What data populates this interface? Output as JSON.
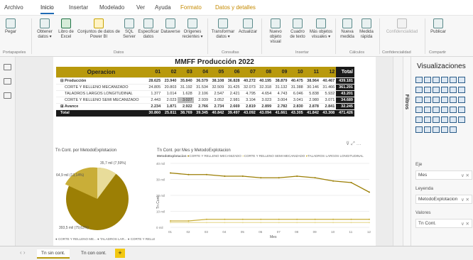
{
  "tabs": [
    "Archivo",
    "Inicio",
    "Insertar",
    "Modelado",
    "Ver",
    "Ayuda",
    "Formato",
    "Datos y detalles"
  ],
  "ribbon": {
    "pegar": "Pegar",
    "obtener": "Obtener datos ▾",
    "libro": "Libro de Excel",
    "conjuntos": "Conjuntos de datos de Power BI",
    "sql": "SQL Server",
    "especificar": "Especificar datos",
    "dataverse": "Dataverse",
    "origenes": "Orígenes recientes ▾",
    "transformar": "Transformar datos ▾",
    "actualizar": "Actualizar",
    "nuevo_objeto": "Nuevo objeto visual",
    "cuadro_texto": "Cuadro de texto",
    "mas_objetos": "Más objetos visuales ▾",
    "nueva_medida": "Nueva medida",
    "medida_rapida": "Medida rápida",
    "confidencialidad": "Confidencialidad",
    "publicar": "Publicar",
    "groups": [
      "Portapapeles",
      "Datos",
      "Consultas",
      "Insertar",
      "Cálculos",
      "Confidencialidad",
      "Compartir"
    ]
  },
  "report": {
    "title": "MMFF Producción 2022"
  },
  "matrix": {
    "headers": [
      "Operacion",
      "01",
      "02",
      "03",
      "04",
      "05",
      "06",
      "07",
      "08",
      "09",
      "10",
      "11",
      "12",
      "Total"
    ],
    "rows": [
      {
        "label": "⊟ Producción",
        "cells": [
          "28.625",
          "23.940",
          "35.840",
          "36.579",
          "38.108",
          "36.828",
          "40.272",
          "40.195",
          "38.879",
          "40.475",
          "38.964",
          "40.467",
          "439.181"
        ],
        "group": true
      },
      {
        "label": "CORTE Y RELLENO MECANIZADO",
        "cells": [
          "24.805",
          "20.803",
          "31.192",
          "31.534",
          "32.509",
          "31.425",
          "32.073",
          "32.318",
          "31.132",
          "31.388",
          "30.146",
          "31.466",
          "361.291"
        ]
      },
      {
        "label": "TALADROS LARGOS LONGITUDINAL",
        "cells": [
          "1.377",
          "1.014",
          "1.628",
          "2.106",
          "2.547",
          "2.421",
          "4.795",
          "4.654",
          "4.743",
          "6.046",
          "5.838",
          "5.932",
          "43.201"
        ]
      },
      {
        "label": "CORTE Y RELLENO SEMI MECANIZADO",
        "cells": [
          "2.443",
          "2.023",
          "3.027",
          "2.939",
          "3.052",
          "2.981",
          "3.104",
          "3.023",
          "3.004",
          "3.041",
          "2.980",
          "3.071",
          "34.689"
        ]
      },
      {
        "label": "⊞ Avance",
        "cells": [
          "2.234",
          "1.871",
          "2.922",
          "2.766",
          "2.734",
          "2.669",
          "2.819",
          "2.899",
          "2.782",
          "2.830",
          "2.878",
          "2.841",
          "32.245"
        ],
        "group": true
      },
      {
        "label": "Total",
        "cells": [
          "30.860",
          "25.811",
          "38.769",
          "39.345",
          "40.842",
          "39.497",
          "43.092",
          "43.094",
          "41.661",
          "43.305",
          "41.842",
          "43.308",
          "471.426"
        ],
        "total": true
      }
    ]
  },
  "pie": {
    "title": "Tn Cont. por MetodoExplotacion",
    "labels": [
      "35,7 mil (7,59%)",
      "64,9 mil (13,14%)",
      "393,5 mil (79,63%)"
    ],
    "legend": "● CORTE Y RELLENO ME... ● TALADROS LAR... ● CORTE Y RELLE..."
  },
  "line": {
    "title": "Tn Cont. por Mes y MetodoExplotacion",
    "legend_title": "MetodoExplotacion",
    "legend": [
      "CORTE Y RELLENO MECANIZADO",
      "CORTE Y RELLENO SEMI MECANIZADO",
      "TALADROS LARGOS LONGITUDINAL"
    ],
    "xlabel": "Mes",
    "ylabel": "Tn Cont.",
    "yticks": [
      "40 mil",
      "30 mil",
      "20 mil",
      "10 mil",
      "0 mil"
    ]
  },
  "chart_data": {
    "type": "line",
    "title": "Tn Cont. por Mes y MetodoExplotacion",
    "x": [
      "01",
      "02",
      "03",
      "04",
      "05",
      "06",
      "07",
      "08",
      "09",
      "10",
      "11",
      "12"
    ],
    "series": [
      {
        "name": "CORTE Y RELLENO MECANIZADO",
        "values": [
          34,
          33,
          33,
          32,
          32,
          31,
          31,
          32,
          31,
          29,
          28,
          22
        ]
      },
      {
        "name": "CORTE Y RELLENO SEMI MECANIZADO",
        "values": [
          3,
          3,
          3,
          3,
          3,
          3,
          3,
          3,
          3,
          3,
          3,
          3
        ]
      },
      {
        "name": "TALADROS LARGOS LONGITUDINAL",
        "values": [
          4,
          4,
          5,
          5,
          5,
          5,
          5,
          5,
          5,
          5,
          5,
          5
        ]
      }
    ],
    "ylim": [
      0,
      40
    ],
    "xlabel": "Mes",
    "ylabel": "Tn Cont."
  },
  "colors": {
    "gold": "#b8990c",
    "dark": "#9c7f05",
    "light": "#e8dc9a",
    "accent": "#f2c811"
  },
  "visualizations": {
    "title": "Visualizaciones",
    "filtros": "Filtros",
    "fields": [
      {
        "label": "Eje",
        "value": "Mes"
      },
      {
        "label": "Leyenda",
        "value": "MetodoExplotacion"
      },
      {
        "label": "Valores",
        "value": "Tn Cont."
      }
    ]
  },
  "pages": [
    "Tn sin cont.",
    "Tn con cont."
  ]
}
